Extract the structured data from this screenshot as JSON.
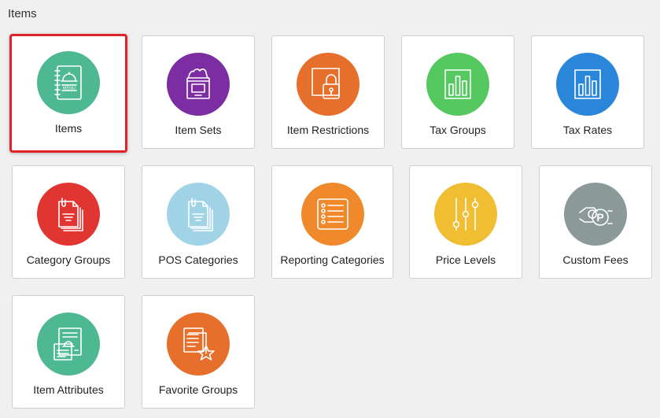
{
  "page": {
    "title": "Items"
  },
  "colors": {
    "teal": "#4db891",
    "purple": "#7d2da2",
    "orange": "#e56f2b",
    "green": "#55c95f",
    "blue": "#2a86d8",
    "red": "#e13532",
    "light_blue": "#a1d3e6",
    "light_orange": "#f0892b",
    "yellow": "#f0bd33",
    "gray": "#8b9999",
    "selected_border": "#e0232a"
  },
  "tiles": [
    {
      "label": "Items",
      "icon": "menu-book-icon",
      "color": "#4db891",
      "selected": true
    },
    {
      "label": "Item Sets",
      "icon": "grocery-bag-icon",
      "color": "#7d2da2",
      "selected": false
    },
    {
      "label": "Item Restrictions",
      "icon": "padlock-icon",
      "color": "#e56f2b",
      "selected": false
    },
    {
      "label": "Tax Groups",
      "icon": "bar-chart-icon",
      "color": "#55c95f",
      "selected": false
    },
    {
      "label": "Tax Rates",
      "icon": "bar-chart-icon",
      "color": "#2a86d8",
      "selected": false
    },
    {
      "label": "Category Groups",
      "icon": "document-stack-icon",
      "color": "#e13532",
      "selected": false
    },
    {
      "label": "POS Categories",
      "icon": "document-stack-icon",
      "color": "#a1d3e6",
      "selected": false
    },
    {
      "label": "Reporting Categories",
      "icon": "checklist-icon",
      "color": "#f0892b",
      "selected": false
    },
    {
      "label": "Price Levels",
      "icon": "sliders-icon",
      "color": "#f0bd33",
      "selected": false
    },
    {
      "label": "Custom Fees",
      "icon": "parking-fee-icon",
      "color": "#8b9999",
      "selected": false
    },
    {
      "label": "Item Attributes",
      "icon": "recipe-card-icon",
      "color": "#4db891",
      "selected": false
    },
    {
      "label": "Favorite Groups",
      "icon": "star-document-icon",
      "color": "#e56f2b",
      "selected": false
    }
  ]
}
